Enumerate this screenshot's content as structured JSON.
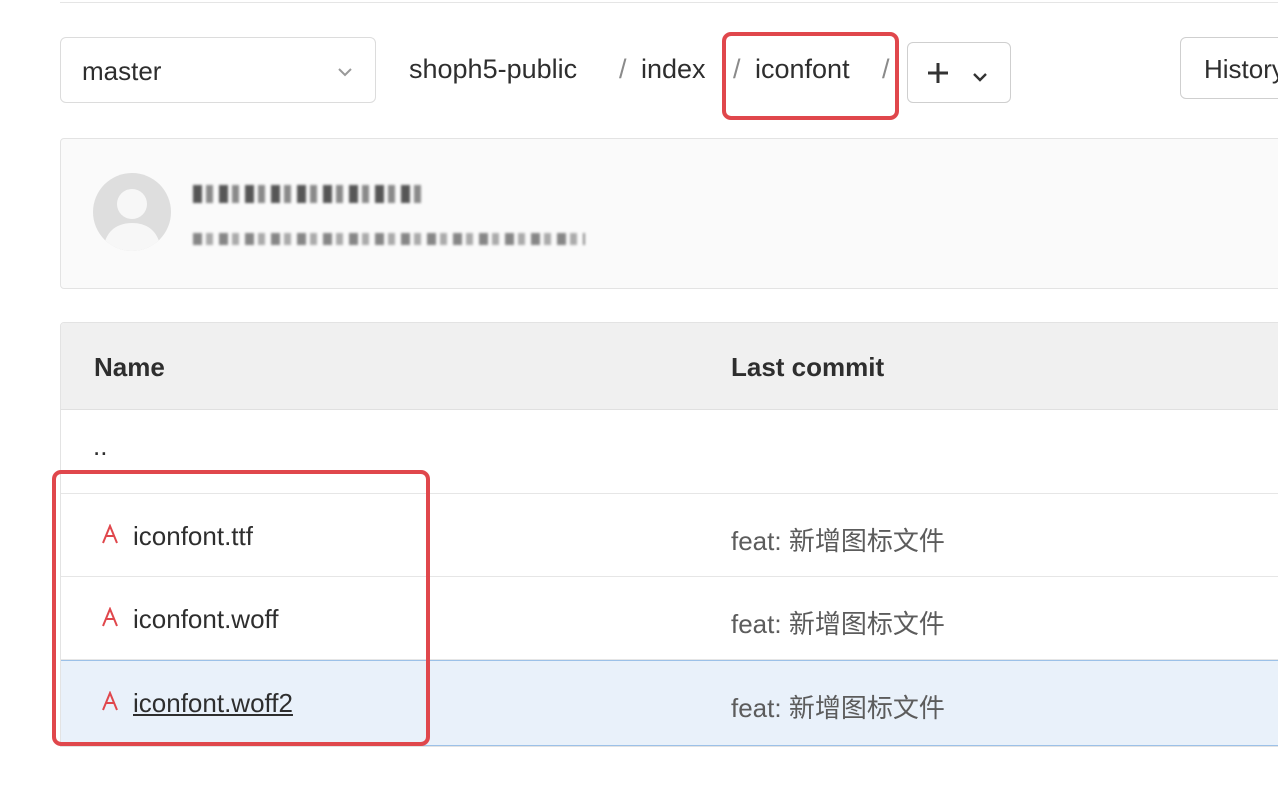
{
  "branch": {
    "selected": "master"
  },
  "breadcrumb": {
    "segments": [
      "shoph5-public",
      "index",
      "iconfont"
    ],
    "separator": "/"
  },
  "toolbar": {
    "add_icon": "plus-icon",
    "history_label": "History"
  },
  "commit_panel": {
    "author_obscured": true,
    "message_obscured": true
  },
  "table": {
    "headers": {
      "name": "Name",
      "last_commit": "Last commit"
    },
    "parent_row": "..",
    "rows": [
      {
        "icon": "font-file-icon",
        "name": "iconfont.ttf",
        "last_commit": "feat: 新增图标文件"
      },
      {
        "icon": "font-file-icon",
        "name": "iconfont.woff",
        "last_commit": "feat: 新增图标文件"
      },
      {
        "icon": "font-file-icon",
        "name": "iconfont.woff2",
        "last_commit": "feat: 新增图标文件"
      }
    ]
  },
  "colors": {
    "highlight": "#e0474c",
    "file_icon": "#e0474c",
    "selected_row": "#e9f1fa"
  }
}
